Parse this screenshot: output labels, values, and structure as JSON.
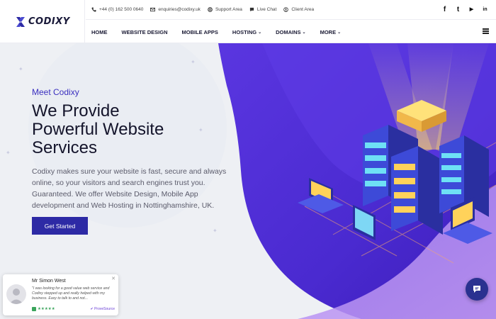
{
  "brand": {
    "name": "CODIXY"
  },
  "topbar": {
    "phone": "+44 (0) 162 500 0640",
    "email": "enquiries@codixy.uk",
    "support": "Support Area",
    "chat": "Live Chat",
    "client": "Client Area"
  },
  "socials": [
    {
      "icon": "facebook-icon",
      "glyph": "f"
    },
    {
      "icon": "twitter-icon",
      "glyph": "t"
    },
    {
      "icon": "youtube-icon",
      "glyph": "▶"
    },
    {
      "icon": "linkedin-icon",
      "glyph": "in"
    }
  ],
  "nav": [
    {
      "label": "HOME",
      "dropdown": false
    },
    {
      "label": "WEBSITE DESIGN",
      "dropdown": false
    },
    {
      "label": "MOBILE APPS",
      "dropdown": false
    },
    {
      "label": "HOSTING",
      "dropdown": true
    },
    {
      "label": "DOMAINS",
      "dropdown": true
    },
    {
      "label": "MORE",
      "dropdown": true
    }
  ],
  "hero": {
    "eyebrow": "Meet Codixy",
    "headline_1": "We Provide",
    "headline_2": "Powerful Website",
    "headline_3": "Services",
    "description": "Codixy makes sure your website is fast, secure and always online, so your visitors and search engines trust you. Guaranteed. We offer Website Design, Mobile App development and Web Hosting in Nottinghamshire, UK.",
    "cta": "Get Started"
  },
  "review": {
    "name": "Mr Simon West",
    "text": "\"I was looking for a good value web service and Codixy stepped up and really helped with my business. Easy to talk to and not...",
    "stars": "★★★★★",
    "source": "ProveSource"
  },
  "colors": {
    "accent": "#2d2aa5",
    "purple": "#5b2fd8",
    "chat": "#2a3190"
  }
}
